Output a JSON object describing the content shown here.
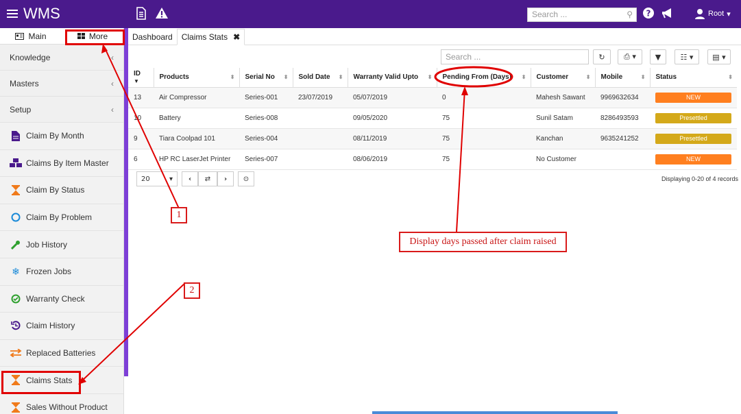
{
  "app": {
    "title": "WMS"
  },
  "topbar": {
    "search_placeholder": "Search ...",
    "user_label": "Root"
  },
  "sidebar": {
    "tabs": [
      {
        "label": "Main"
      },
      {
        "label": "More"
      }
    ],
    "groups": [
      {
        "label": "Knowledge"
      },
      {
        "label": "Masters"
      },
      {
        "label": "Setup"
      }
    ],
    "items": [
      {
        "label": "Claim By Month",
        "icon": "document-icon",
        "color": "#4a1a8c"
      },
      {
        "label": "Claims By Item Master",
        "icon": "cubes-icon",
        "color": "#4a1a8c"
      },
      {
        "label": "Claim By Status",
        "icon": "hourglass-icon",
        "color": "#f07a1a"
      },
      {
        "label": "Claim By Problem",
        "icon": "circle-icon",
        "color": "#1a8ad8"
      },
      {
        "label": "Job History",
        "icon": "wrench-icon",
        "color": "#2ea02e"
      },
      {
        "label": "Frozen Jobs",
        "icon": "snowflake-icon",
        "color": "#1a8ad8"
      },
      {
        "label": "Warranty Check",
        "icon": "check-circle-icon",
        "color": "#2ea02e"
      },
      {
        "label": "Claim History",
        "icon": "history-icon",
        "color": "#4a1a8c"
      },
      {
        "label": "Replaced Batteries",
        "icon": "exchange-icon",
        "color": "#f07a1a"
      },
      {
        "label": "Claims Stats",
        "icon": "hourglass-icon",
        "color": "#f07a1a"
      },
      {
        "label": "Sales Without Product",
        "icon": "hourglass-icon",
        "color": "#f07a1a"
      }
    ]
  },
  "main": {
    "tabs": [
      {
        "label": "Dashboard"
      },
      {
        "label": "Claims Stats"
      }
    ],
    "search_placeholder": "Search ...",
    "columns": [
      "ID",
      "Products",
      "Serial No",
      "Sold Date",
      "Warranty Valid Upto",
      "Pending From (Days)",
      "Customer",
      "Mobile",
      "Status"
    ],
    "rows": [
      {
        "id": "13",
        "product": "Air Compressor",
        "serial": "Series-001",
        "sold": "23/07/2019",
        "warranty": "05/07/2019",
        "pending": "0",
        "customer": "Mahesh Sawant",
        "mobile": "9969632634",
        "status": "NEW",
        "status_color": "#ff7f1f"
      },
      {
        "id": "10",
        "product": "Battery",
        "serial": "Series-008",
        "sold": "",
        "warranty": "09/05/2020",
        "pending": "75",
        "customer": "Sunil Satam",
        "mobile": "8286493593",
        "status": "Presettled",
        "status_color": "#d4a91a"
      },
      {
        "id": "9",
        "product": "Tiara Coolpad 101",
        "serial": "Series-004",
        "sold": "",
        "warranty": "08/11/2019",
        "pending": "75",
        "customer": "Kanchan",
        "mobile": "9635241252",
        "status": "Presettled",
        "status_color": "#d4a91a"
      },
      {
        "id": "6",
        "product": "HP RC LaserJet Printer",
        "serial": "Series-007",
        "sold": "",
        "warranty": "08/06/2019",
        "pending": "75",
        "customer": "No Customer",
        "mobile": "",
        "status": "NEW",
        "status_color": "#ff7f1f"
      }
    ],
    "page_size": "20",
    "records_text": "Displaying 0-20 of 4 records"
  },
  "annotations": {
    "callout_1": "1",
    "callout_2": "2",
    "callout_text": "Display days passed after claim raised",
    "color": "#e00000"
  }
}
